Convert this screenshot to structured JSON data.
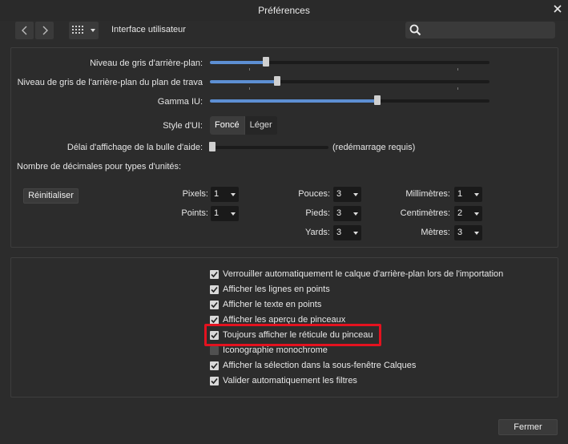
{
  "window": {
    "title": "Préférences"
  },
  "toolbar": {
    "section_label": "Interface utilisateur"
  },
  "settings": {
    "bg_gray_label": "Niveau de gris d'arrière-plan:",
    "bg_gray_value": 0.2,
    "workspace_gray_label": "Niveau de gris de l'arrière-plan du plan de trava",
    "workspace_gray_value": 0.24,
    "gamma_label": "Gamma IU:",
    "gamma_value": 0.6,
    "ui_style_label": "Style d'UI:",
    "ui_style_options": [
      "Foncé",
      "Léger"
    ],
    "ui_style_selected": "Foncé",
    "tooltip_delay_label": "Délai d'affichage de la bulle d'aide:",
    "tooltip_delay_value": 0.02,
    "tooltip_delay_note": "(redémarrage requis)",
    "decimals_label": "Nombre de décimales pour types d'unités:"
  },
  "decimals": {
    "reset_button": "Réinitialiser",
    "units": [
      {
        "label": "Pixels:",
        "value": "1"
      },
      {
        "label": "Points:",
        "value": "1"
      },
      {
        "label": "Pouces:",
        "value": "3"
      },
      {
        "label": "Pieds:",
        "value": "3"
      },
      {
        "label": "Yards:",
        "value": "3"
      },
      {
        "label": "Millimètres:",
        "value": "1"
      },
      {
        "label": "Centimètres:",
        "value": "2"
      },
      {
        "label": "Mètres:",
        "value": "3"
      }
    ]
  },
  "options": [
    {
      "label": "Verrouiller automatiquement le calque d'arrière-plan lors de l'importation",
      "checked": true
    },
    {
      "label": "Afficher les lignes en points",
      "checked": true
    },
    {
      "label": "Afficher le texte en points",
      "checked": true
    },
    {
      "label": "Afficher les aperçu de pinceaux",
      "checked": true
    },
    {
      "label": "Toujours afficher le réticule du pinceau",
      "checked": true
    },
    {
      "label": "Iconographie monochrome",
      "checked": false
    },
    {
      "label": "Afficher la sélection dans la sous-fenêtre Calques",
      "checked": true
    },
    {
      "label": "Valider automatiquement les filtres",
      "checked": true
    }
  ],
  "footer": {
    "close_button": "Fermer"
  }
}
